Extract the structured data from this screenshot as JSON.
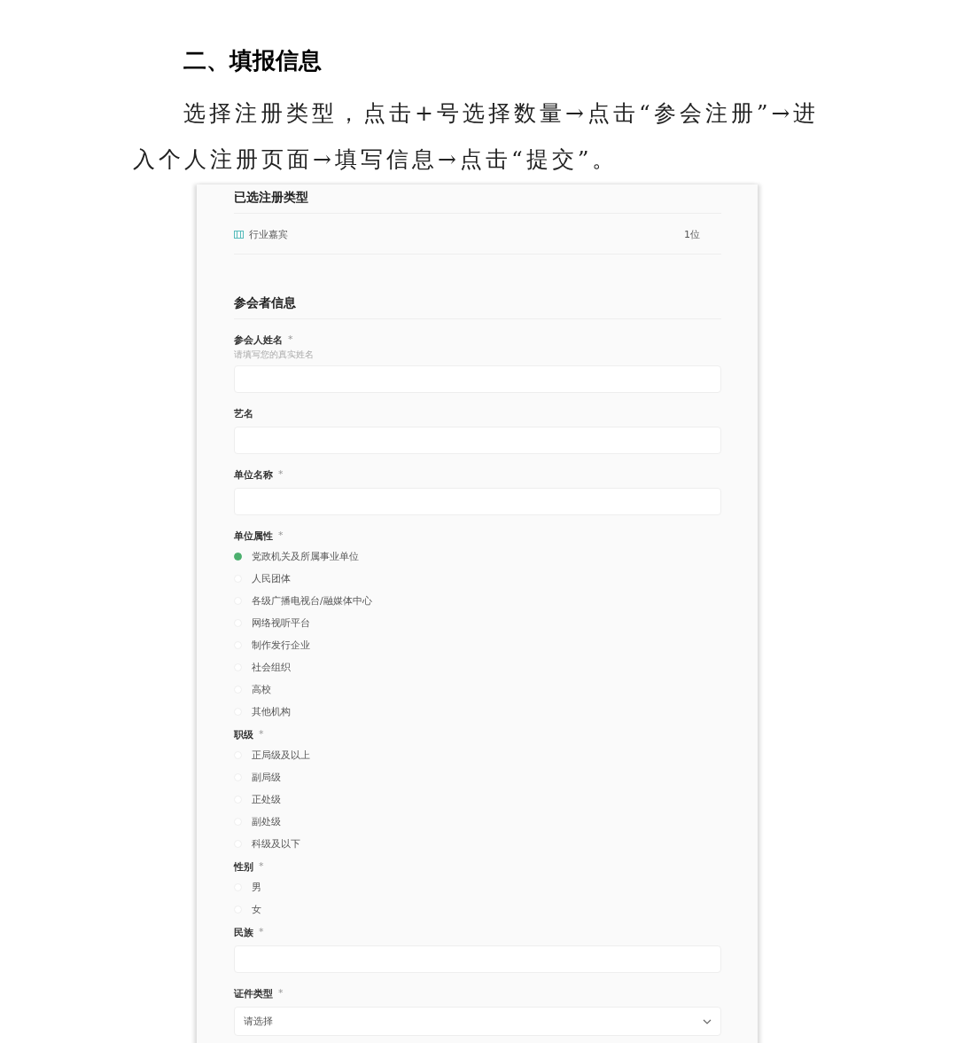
{
  "heading": "二、填报信息",
  "instruction": "选择注册类型，点击+号选择数量→点击“参会注册”→进入个人注册页面→填写信息→点击“提交”。",
  "selected_types": {
    "title": "已选注册类型",
    "items": [
      {
        "name": "行业嘉宾",
        "count": "1位"
      }
    ]
  },
  "attendee": {
    "title": "参会者信息",
    "fields": [
      {
        "kind": "text",
        "label": "参会人姓名",
        "required_mark": "*",
        "hint": "请填写您的真实姓名"
      },
      {
        "kind": "text",
        "label": "艺名"
      },
      {
        "kind": "text",
        "label": "单位名称",
        "required_mark": "*"
      },
      {
        "kind": "radio",
        "label": "单位属性",
        "required_mark": "*",
        "options": [
          {
            "label": "党政机关及所属事业单位",
            "selected": true
          },
          {
            "label": "人民团体",
            "selected": false
          },
          {
            "label": "各级广播电视台/融媒体中心",
            "selected": false
          },
          {
            "label": "网络视听平台",
            "selected": false
          },
          {
            "label": "制作发行企业",
            "selected": false
          },
          {
            "label": "社会组织",
            "selected": false
          },
          {
            "label": "高校",
            "selected": false
          },
          {
            "label": "其他机构",
            "selected": false
          }
        ]
      },
      {
        "kind": "radio",
        "label": "职级",
        "required_mark": "*",
        "options": [
          {
            "label": "正局级及以上",
            "selected": false
          },
          {
            "label": "副局级",
            "selected": false
          },
          {
            "label": "正处级",
            "selected": false
          },
          {
            "label": "副处级",
            "selected": false
          },
          {
            "label": "科级及以下",
            "selected": false
          }
        ]
      },
      {
        "kind": "radio",
        "label": "性别",
        "required_mark": "*",
        "options": [
          {
            "label": "男",
            "selected": false
          },
          {
            "label": "女",
            "selected": false
          }
        ]
      },
      {
        "kind": "text",
        "label": "民族",
        "required_mark": "*"
      },
      {
        "kind": "select",
        "label": "证件类型",
        "required_mark": "*",
        "placeholder": "请选择"
      }
    ]
  }
}
